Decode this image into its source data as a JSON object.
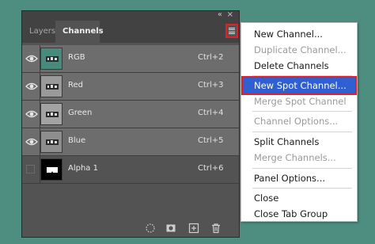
{
  "panel": {
    "tabs": [
      {
        "label": "Layers"
      },
      {
        "label": "Channels"
      }
    ],
    "collapse_glyph": "«",
    "close_glyph": "×",
    "channels": [
      {
        "name": "RGB",
        "shortcut": "Ctrl+2",
        "visible": true,
        "thumb_bg": "#4a8a7d"
      },
      {
        "name": "Red",
        "shortcut": "Ctrl+3",
        "visible": true,
        "thumb_bg": "#9a9a9a"
      },
      {
        "name": "Green",
        "shortcut": "Ctrl+4",
        "visible": true,
        "thumb_bg": "#a3a3a3"
      },
      {
        "name": "Blue",
        "shortcut": "Ctrl+5",
        "visible": true,
        "thumb_bg": "#8e8e8e"
      },
      {
        "name": "Alpha 1",
        "shortcut": "Ctrl+6",
        "visible": false,
        "thumb_bg": "#000000"
      }
    ],
    "footer_icons": [
      "load-selection-icon",
      "save-selection-mask-icon",
      "new-channel-icon",
      "delete-channel-icon"
    ]
  },
  "menu": {
    "items": [
      {
        "label": "New Channel...",
        "enabled": true
      },
      {
        "label": "Duplicate Channel...",
        "enabled": false
      },
      {
        "label": "Delete Channels",
        "enabled": true
      },
      {
        "label": "New Spot Channel...",
        "enabled": true,
        "highlighted": true
      },
      {
        "label": "Merge Spot Channel",
        "enabled": false
      },
      {
        "label": "Channel Options...",
        "enabled": false
      },
      {
        "label": "Split Channels",
        "enabled": true
      },
      {
        "label": "Merge Channels...",
        "enabled": false
      },
      {
        "label": "Panel Options...",
        "enabled": true
      },
      {
        "label": "Close",
        "enabled": true
      },
      {
        "label": "Close Tab Group",
        "enabled": true
      }
    ]
  },
  "colors": {
    "background": "#4e8e80",
    "highlight": "#2f5fd0",
    "annotation_red": "#e0202a"
  }
}
